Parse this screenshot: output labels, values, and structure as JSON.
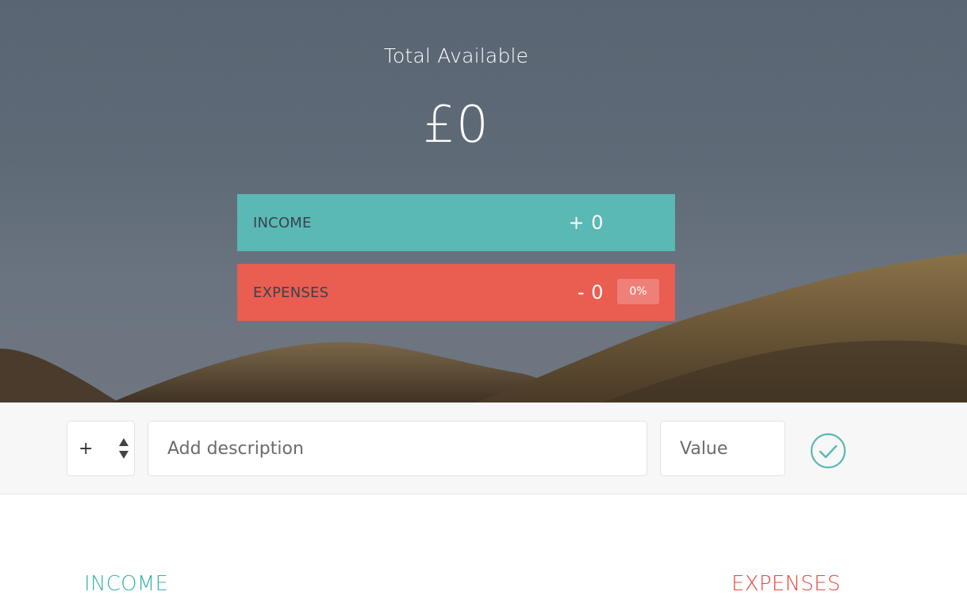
{
  "header": {
    "title": "Total Available",
    "total": "£0"
  },
  "budget": {
    "income": {
      "label": "INCOME",
      "value": "+ 0"
    },
    "expenses": {
      "label": "EXPENSES",
      "value": "- 0",
      "percentage": "0%"
    }
  },
  "add_form": {
    "type_value": "+",
    "description_placeholder": "Add description",
    "value_placeholder": "Value",
    "submit_icon": "check-circle-icon"
  },
  "lists": {
    "income_title": "INCOME",
    "expenses_title": "EXPENSES"
  },
  "colors": {
    "income": "#5ab8b5",
    "expenses": "#ea5d51",
    "income_text": "#3ab0ab",
    "expenses_text": "#e5483d"
  }
}
